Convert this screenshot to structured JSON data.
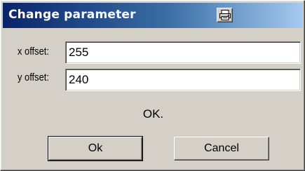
{
  "dialog": {
    "title": "Change parameter"
  },
  "fields": [
    {
      "label": "x offset:",
      "value": "255"
    },
    {
      "label": "y offset:",
      "value": "240"
    }
  ],
  "status": "OK.",
  "buttons": {
    "ok_label": "Ok",
    "cancel_label": "Cancel"
  },
  "icons": {
    "title_button": "printer-icon"
  }
}
